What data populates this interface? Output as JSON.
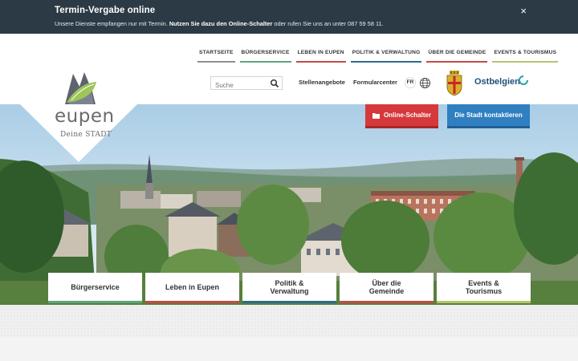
{
  "notice": {
    "title": "Termin-Vergabe online",
    "text_prefix": "Unsere Dienste empfangen nur mit Termin. ",
    "text_bold": "Nutzen Sie dazu den Online-Schalter",
    "text_suffix": " oder rufen Sie uns an unter 087 59 58 11.",
    "close_label": "×"
  },
  "topnav": [
    {
      "label": "STARTSEITE"
    },
    {
      "label": "BÜRGERSERVICE"
    },
    {
      "label": "LEBEN IN EUPEN"
    },
    {
      "label": "POLITIK & VERWALTUNG"
    },
    {
      "label": "ÜBER DIE GEMEINDE"
    },
    {
      "label": "EVENTS & TOURISMUS"
    }
  ],
  "search": {
    "placeholder": "Suche"
  },
  "links": {
    "jobs": "Stellenangebote",
    "forms": "Formularcenter"
  },
  "lang": "FR",
  "ostbelgien": "Ostbelgien",
  "logo": {
    "word": "eupen",
    "tagline": "Deine STADT"
  },
  "buttons": {
    "online": "Online-Schalter",
    "contact": "Die Stadt kontaktieren"
  },
  "tiles": [
    {
      "line1": "Bürgerservice",
      "line2": ""
    },
    {
      "line1": "Leben in Eupen",
      "line2": ""
    },
    {
      "line1": "Politik &",
      "line2": "Verwaltung"
    },
    {
      "line1": "Über die",
      "line2": "Gemeinde"
    },
    {
      "line1": "Events &",
      "line2": "Tourismus"
    }
  ],
  "colors": {
    "notice_bg": "#2b3a44",
    "online_red": "#d5393b",
    "contact_blue": "#2f7fc1",
    "green": "#5fa37a",
    "red": "#c24b46",
    "petrol": "#2a6d8c",
    "lime": "#b6c46c"
  }
}
